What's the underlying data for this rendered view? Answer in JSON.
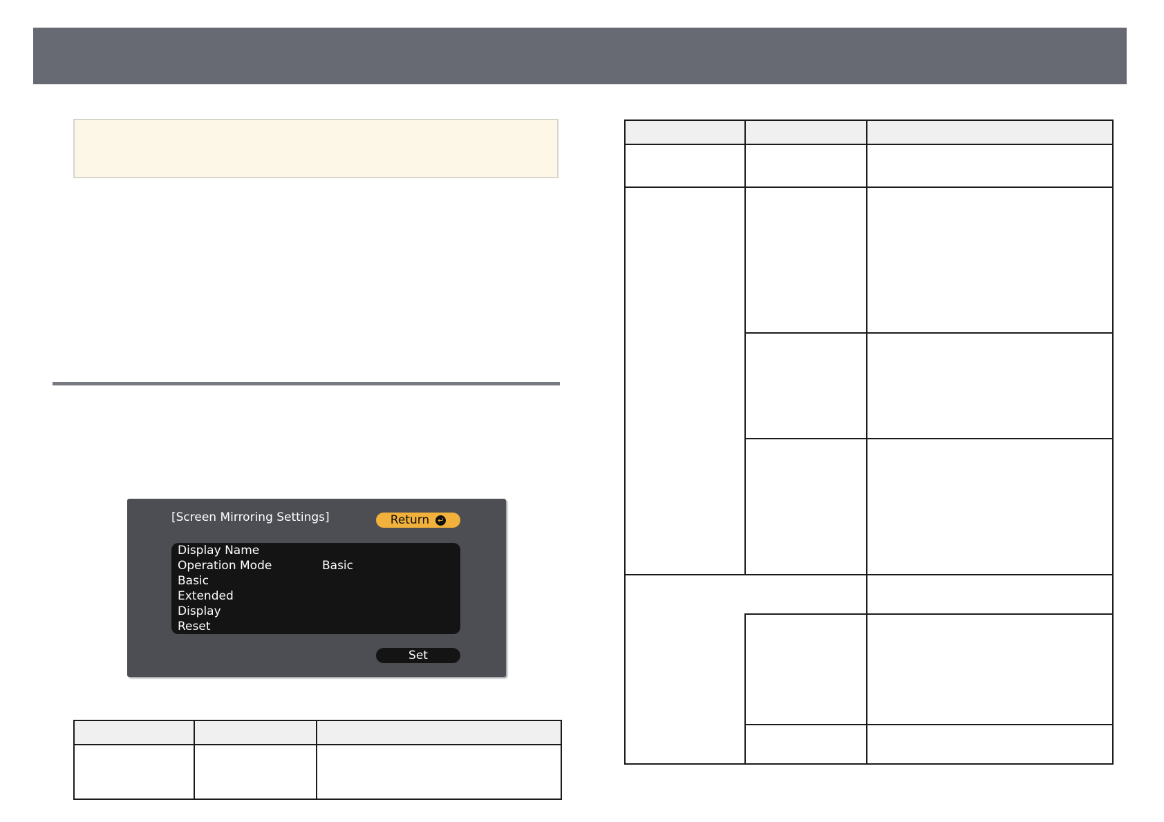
{
  "osd": {
    "title": "[Screen Mirroring Settings]",
    "return_label": "Return",
    "return_icon": "enter-icon",
    "items": [
      {
        "label": "Display Name",
        "value": ""
      },
      {
        "label": "Operation Mode",
        "value": "Basic"
      },
      {
        "label": "Basic",
        "value": ""
      },
      {
        "label": "Extended",
        "value": ""
      },
      {
        "label": "Display",
        "value": ""
      },
      {
        "label": "Reset",
        "value": ""
      }
    ],
    "set_label": "Set"
  }
}
